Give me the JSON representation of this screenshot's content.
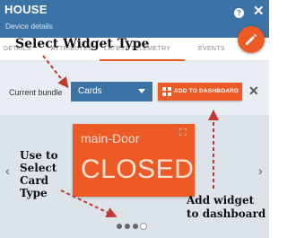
{
  "header": {
    "title": "HOUSE",
    "subtitle": "Device details",
    "help_label": "?",
    "close_label": "✕"
  },
  "tabs": [
    {
      "label": "DETAILS"
    },
    {
      "label": "ATTRIBUTES"
    },
    {
      "label": "LATEST TELEMETRY"
    },
    {
      "label": "EVENTS"
    }
  ],
  "bundle": {
    "label": "Current bundle",
    "selected": "Cards",
    "add_button": "ADD TO DASHBOARD",
    "close_label": "✕"
  },
  "widget": {
    "title": "main-Door",
    "value": "CLOSED"
  },
  "carousel": {
    "prev_label": "‹",
    "next_label": "›",
    "page_count": 4,
    "active_page": 4
  },
  "annotations": {
    "select_widget": "Select Widget Type",
    "select_card": [
      "Use to",
      "Select",
      "Card",
      "Type"
    ],
    "add_widget": [
      "Add widget",
      "to dashboard"
    ]
  },
  "colors": {
    "header": "#3b73a6",
    "accent": "#ec5a25",
    "arrow": "#c0392b"
  },
  "icons": {
    "edit": "pencil-icon",
    "dashboard": "grid-icon",
    "fullscreen": "fullscreen-icon"
  }
}
